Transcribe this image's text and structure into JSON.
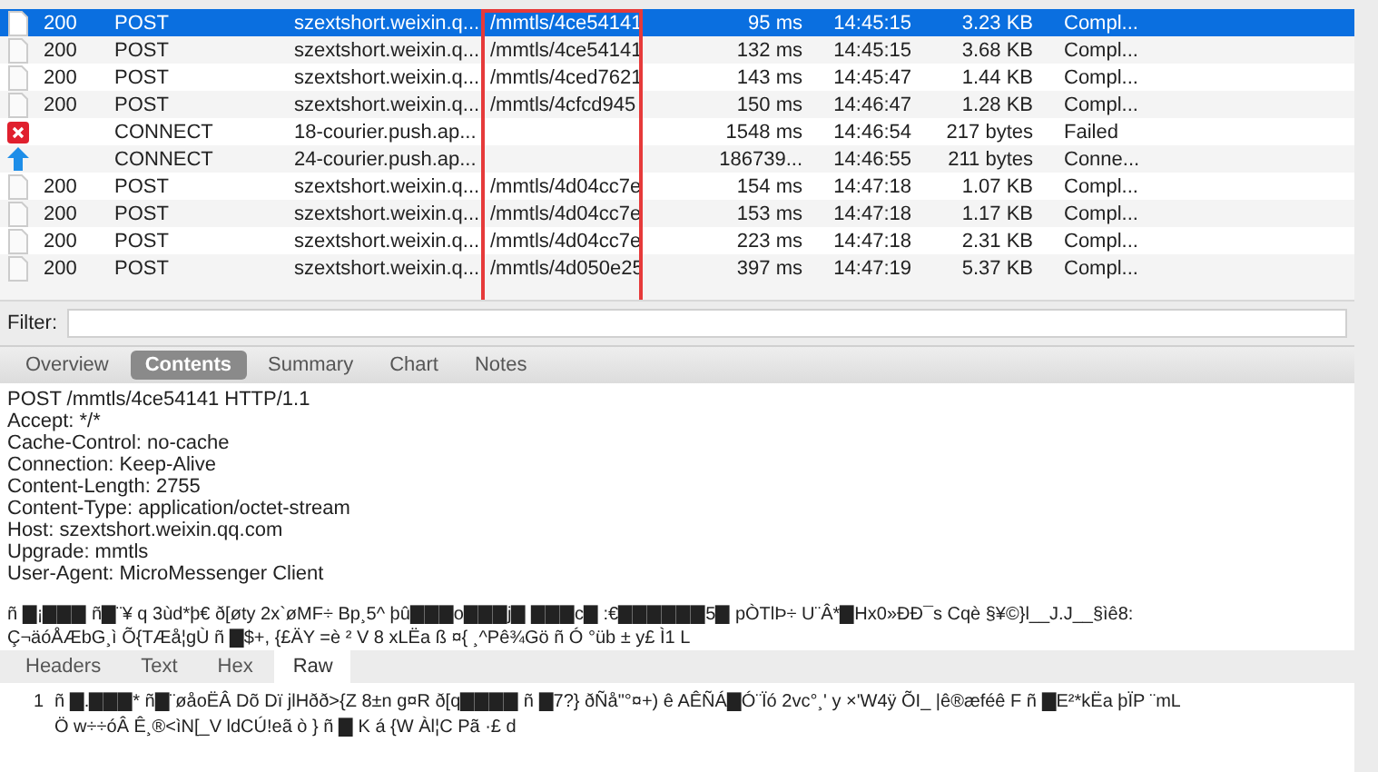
{
  "requests": [
    {
      "kind": "file",
      "code": "200",
      "method": "POST",
      "host": "szextshort.weixin.q...",
      "path": "/mmtls/4ce54141",
      "duration": "95 ms",
      "time": "14:45:15",
      "size": "3.23 KB",
      "status": "Compl...",
      "selected": true
    },
    {
      "kind": "file",
      "code": "200",
      "method": "POST",
      "host": "szextshort.weixin.q...",
      "path": "/mmtls/4ce54141",
      "duration": "132 ms",
      "time": "14:45:15",
      "size": "3.68 KB",
      "status": "Compl...",
      "selected": false
    },
    {
      "kind": "file",
      "code": "200",
      "method": "POST",
      "host": "szextshort.weixin.q...",
      "path": "/mmtls/4ced7621",
      "duration": "143 ms",
      "time": "14:45:47",
      "size": "1.44 KB",
      "status": "Compl...",
      "selected": false
    },
    {
      "kind": "file",
      "code": "200",
      "method": "POST",
      "host": "szextshort.weixin.q...",
      "path": "/mmtls/4cfcd945",
      "duration": "150 ms",
      "time": "14:46:47",
      "size": "1.28 KB",
      "status": "Compl...",
      "selected": false
    },
    {
      "kind": "failed",
      "method": "CONNECT",
      "host": "18-courier.push.ap...",
      "duration": "1548 ms",
      "time": "14:46:54",
      "size": "217 bytes",
      "status": "Failed",
      "selected": false
    },
    {
      "kind": "upload",
      "method": "CONNECT",
      "host": "24-courier.push.ap...",
      "duration": "186739...",
      "time": "14:46:55",
      "size": "211 bytes",
      "status": "Conne...",
      "selected": false
    },
    {
      "kind": "file",
      "code": "200",
      "method": "POST",
      "host": "szextshort.weixin.q...",
      "path": "/mmtls/4d04cc7e",
      "duration": "154 ms",
      "time": "14:47:18",
      "size": "1.07 KB",
      "status": "Compl...",
      "selected": false
    },
    {
      "kind": "file",
      "code": "200",
      "method": "POST",
      "host": "szextshort.weixin.q...",
      "path": "/mmtls/4d04cc7e",
      "duration": "153 ms",
      "time": "14:47:18",
      "size": "1.17 KB",
      "status": "Compl...",
      "selected": false
    },
    {
      "kind": "file",
      "code": "200",
      "method": "POST",
      "host": "szextshort.weixin.q...",
      "path": "/mmtls/4d04cc7e",
      "duration": "223 ms",
      "time": "14:47:18",
      "size": "2.31 KB",
      "status": "Compl...",
      "selected": false
    },
    {
      "kind": "file",
      "code": "200",
      "method": "POST",
      "host": "szextshort.weixin.q...",
      "path": "/mmtls/4d050e25",
      "duration": "397 ms",
      "time": "14:47:19",
      "size": "5.37 KB",
      "status": "Compl...",
      "selected": false
    }
  ],
  "filter": {
    "label": "Filter:"
  },
  "detail_tabs": [
    {
      "label": "Overview",
      "selected": false
    },
    {
      "label": "Contents",
      "selected": true
    },
    {
      "label": "Summary",
      "selected": false
    },
    {
      "label": "Chart",
      "selected": false
    },
    {
      "label": "Notes",
      "selected": false
    }
  ],
  "request_headers": [
    "POST /mmtls/4ce54141 HTTP/1.1",
    "Accept: */*",
    "Cache-Control: no-cache",
    "Connection: Keep-Alive",
    "Content-Length: 2755",
    "Content-Type: application/octet-stream",
    "Host: szextshort.weixin.qq.com",
    "Upgrade: mmtls",
    "User-Agent: MicroMessenger Client"
  ],
  "body_lines": [
    "ñ ▇¡▇▇▇    ñ▇¨¥ q 3ùd*þ€   ð[øty      2x`øMF÷   Bp¸5^   þû▇▇▇o▇▇▇j▇ ▇▇▇c▇ :€▇▇▇▇▇▇5▇     pÒTlÞ÷ U¨Â*▇Hx0»ÐÐ¯s   Cqè    §¥©}l__J.J__§ìê8:",
    "Ç¬äóÅÆbG¸ì   Õ{TÆå¦gÙ ñ ▇$+, {£ÄY =è ²   V 8   xLËa   ß ¤{       ¸^Pê¾Gö ñ   Ó °üb  ±   y£   Ì1   L"
  ],
  "response_tabs": [
    {
      "label": "Headers",
      "selected": false
    },
    {
      "label": "Text",
      "selected": false
    },
    {
      "label": "Hex",
      "selected": false
    },
    {
      "label": "Raw",
      "selected": true
    }
  ],
  "raw": {
    "line_number": "1",
    "lines": [
      "ñ ▇.▇▇▇*  ñ▇¨øåoËÂ Dõ Dï   jlHðð>{Z    8±n    g¤R ð[q▇▇▇▇ ñ ▇7?}    ðÑå\"°¤+)    ê AÊÑÁ▇Ó¨Ïó 2vc°¸' y    ×'W4ÿ     ÕI_ |ê®æféê  F ñ ▇E²*kËa þÏP ¨mL",
      "Ö w÷÷óÂ   Ê¸®<ìN[_V     ldCÚ!eã ò } ñ ▇    K á {W    Àl¦C Pã        ·£ d"
    ]
  }
}
